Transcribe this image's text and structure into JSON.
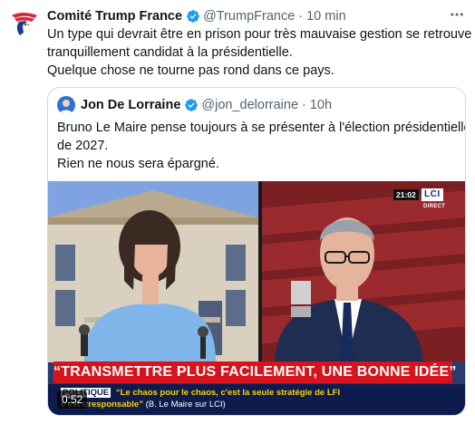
{
  "tweet": {
    "author_name": "Comité Trump France",
    "author_handle": "@TrumpFrance",
    "separator": "·",
    "time": "10 min",
    "more_icon": "more-horizontal-icon",
    "verified_icon": "verified-badge-icon",
    "text_lines": [
      "Un type qui devrait être en prison pour très mauvaise gestion se retrouve",
      "tranquillement candidat à la présidentielle.",
      "Quelque chose ne tourne pas rond dans ce pays."
    ]
  },
  "quote": {
    "author_name": "Jon De Lorraine",
    "author_handle": "@jon_delorraine",
    "separator": "·",
    "time": "10h",
    "text_lines": [
      "Bruno Le Maire pense toujours à se présenter à l'élection présidentielle",
      "de 2027.",
      "Rien ne nous sera épargné."
    ],
    "video": {
      "clock": "21:02",
      "channel": "LCI",
      "live_label": "DIRECT",
      "headline": "“TRANSMETTRE PLUS FACILEMENT, UNE BONNE IDÉE”",
      "ticker_tag": "POLITIQUE",
      "ticker_line1": "“Le chaos pour le chaos, c'est la seule stratégie de LFI",
      "ticker_line2": "c'est irresponsable”",
      "ticker_source": "(B. Le Maire sur LCI)",
      "duration": "0:52"
    }
  },
  "colors": {
    "text_primary": "#0f1419",
    "text_secondary": "#536471",
    "verified_blue": "#1d9bf0",
    "border": "#cfd9de",
    "banner_red": "#d7141d",
    "ticker_navy": "#0d1b4d"
  }
}
